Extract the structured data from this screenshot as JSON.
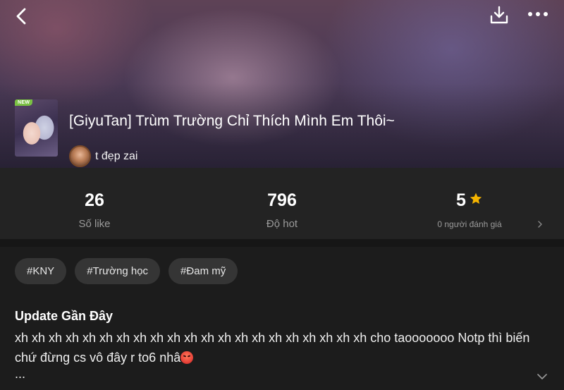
{
  "header": {
    "back_icon": "chevron-left-icon",
    "download_icon": "download-icon",
    "more_icon": "more-horizontal-icon"
  },
  "comic": {
    "badge": "NEW",
    "title": "[GiyuTan] Trùm Trường Chỉ Thích Mình Em Thôi~",
    "author": "t đẹp zai"
  },
  "stats": {
    "likes": {
      "value": "26",
      "label": "Số like"
    },
    "hot": {
      "value": "796",
      "label": "Độ hot"
    },
    "rating": {
      "value": "5",
      "label": "0 người đánh giá",
      "star_color": "#f5b400"
    }
  },
  "tags": [
    "#KNY",
    "#Trường học",
    "#Đam mỹ"
  ],
  "update": {
    "heading": "Update Gần Đây",
    "text": "xh xh xh xh xh xh xh xh xh xh xh xh xh xh xh xh xh xh xh xh xh cho taooooooo Notp thì biến chứ đừng cs vô đây r to6 nhâ",
    "emoji": "angry-face-emoji",
    "ellipsis": "..."
  },
  "colors": {
    "background": "#1c1c1c",
    "stats_background": "#232323",
    "tag_background": "#353535",
    "muted_text": "#9a9a9a"
  }
}
